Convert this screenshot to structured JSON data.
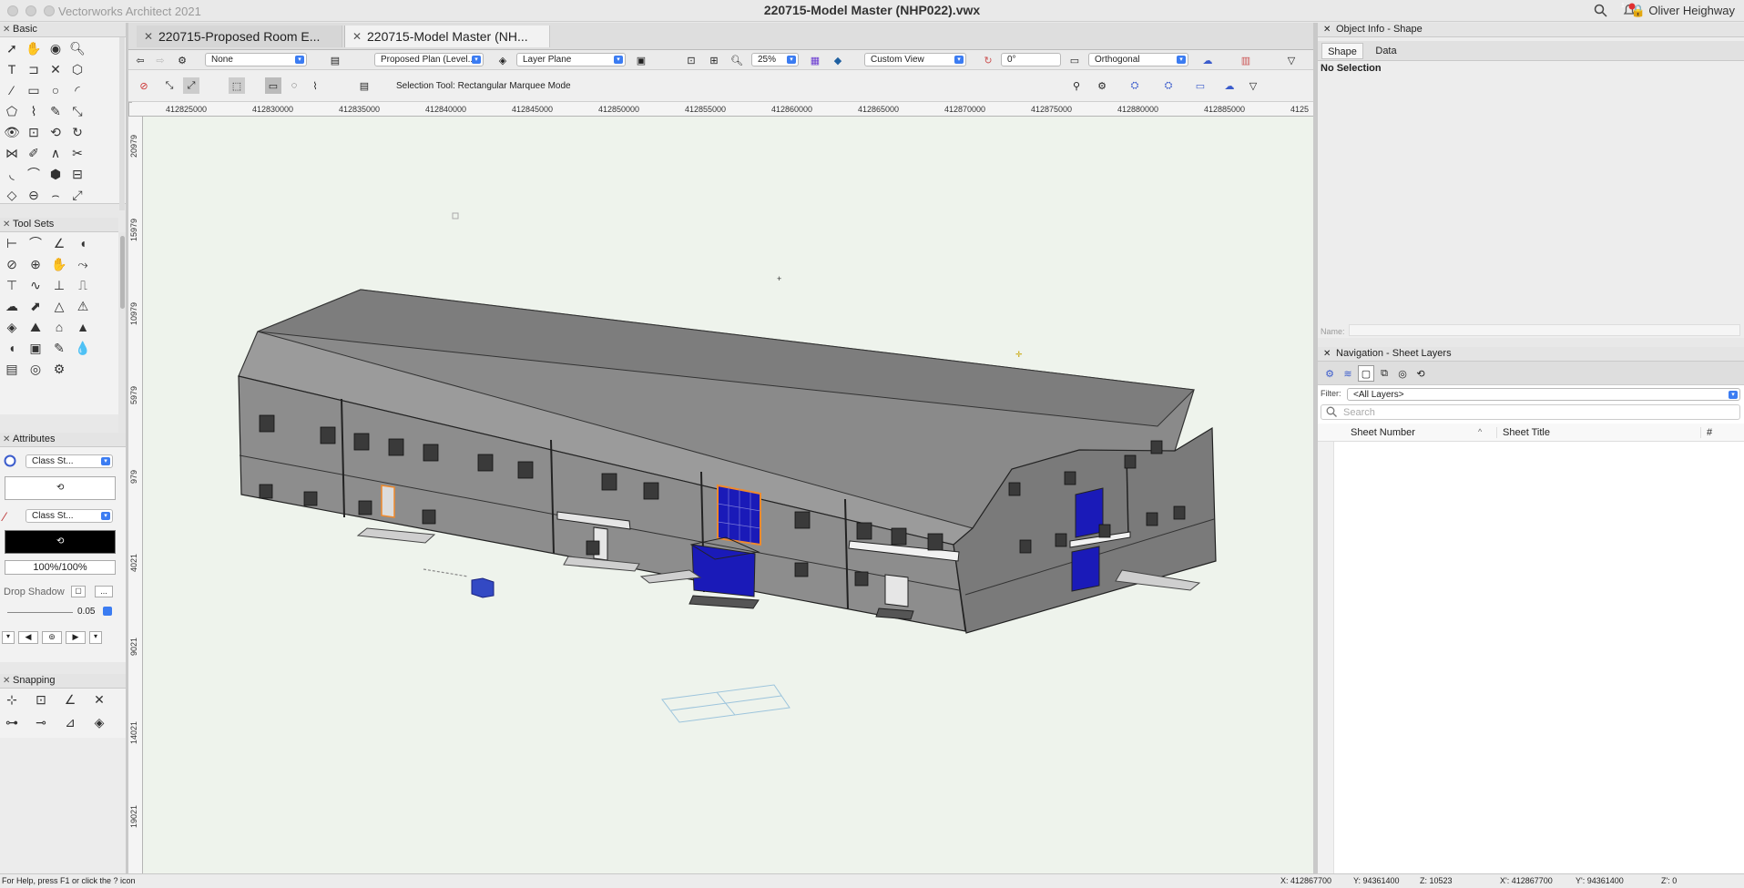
{
  "app": {
    "name": "Vectorworks Architect 2021",
    "user": "Oliver Heighway",
    "notification_count": "1"
  },
  "document": {
    "title": "220715-Model Master (NHP022).vwx"
  },
  "tabs": [
    {
      "label": "220715-Proposed Room E..."
    },
    {
      "label": "220715-Model Master (NH..."
    }
  ],
  "view_bar": {
    "class": "None",
    "layer": "Proposed Plan (Level...",
    "plane": "Layer Plane",
    "zoom": "25%",
    "view": "Custom View",
    "rotation": "0°",
    "projection": "Orthogonal"
  },
  "mode_bar": {
    "mode_text": "Selection Tool: Rectangular Marquee Mode"
  },
  "palettes": {
    "basic": "Basic",
    "tool_sets": "Tool Sets",
    "attributes": "Attributes",
    "snapping": "Snapping"
  },
  "attributes": {
    "fill_style": "Class St...",
    "pen_style": "Class St...",
    "opacity": "100%/100%",
    "drop_shadow": "Drop Shadow",
    "line_weight": "0.05",
    "drop_shadow_btn": "..."
  },
  "ruler": {
    "h": [
      "412825000",
      "412830000",
      "412835000",
      "412840000",
      "412845000",
      "412850000",
      "412855000",
      "412860000",
      "412865000",
      "412870000",
      "412875000",
      "412880000",
      "412885000",
      "4125"
    ],
    "v": [
      "20979",
      "15979",
      "10979",
      "5979",
      "979",
      "4021",
      "9021",
      "14021",
      "19021"
    ]
  },
  "object_info": {
    "title": "Object Info - Shape",
    "tab_shape": "Shape",
    "tab_data": "Data",
    "selection": "No Selection",
    "name_label": "Name:"
  },
  "navigation": {
    "title": "Navigation - Sheet Layers",
    "filter_label": "Filter:",
    "filter_value": "<All Layers>",
    "search_placeholder": "Search",
    "col_number": "Sheet Number",
    "col_title": "Sheet Title",
    "col_hash": "#"
  },
  "status": {
    "help": "For Help, press F1 or click the ? icon",
    "x": "X: 412867700",
    "y": "Y: 94361400",
    "z": "Z: 10523",
    "x2": "X': 412867700",
    "y2": "Y': 94361400",
    "z2": "Z': 0"
  },
  "colors": {
    "canvas": "#eef3ec",
    "accent": "#3b7cf2",
    "glass": "#1a1ab8"
  }
}
